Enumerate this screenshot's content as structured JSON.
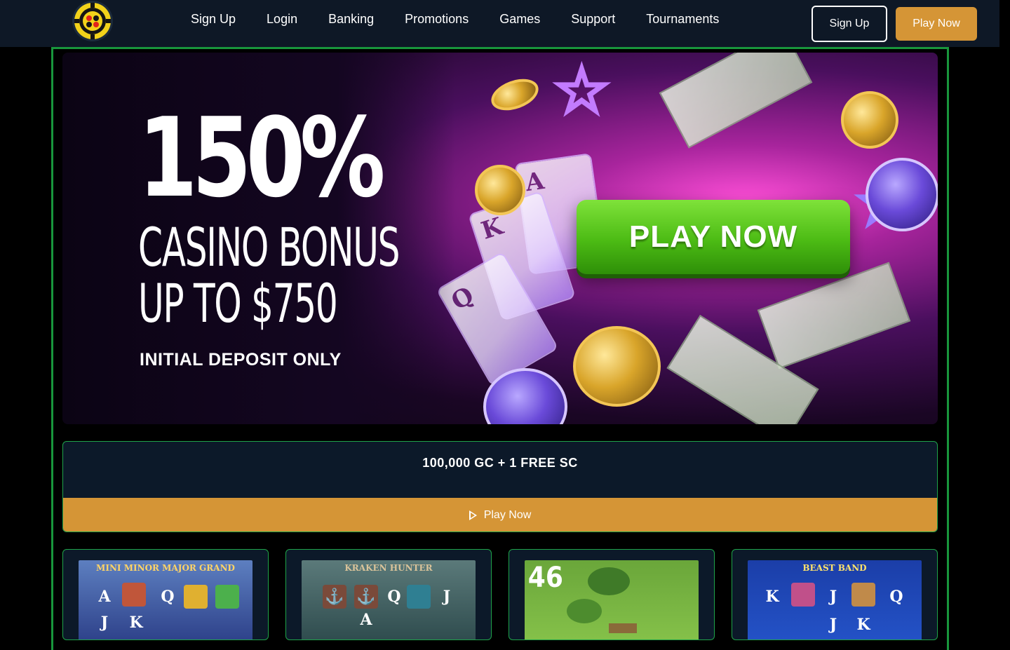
{
  "nav": {
    "items": [
      {
        "label": "Sign Up"
      },
      {
        "label": "Login"
      },
      {
        "label": "Banking"
      },
      {
        "label": "Promotions"
      },
      {
        "label": "Games"
      },
      {
        "label": "Support"
      },
      {
        "label": "Tournaments"
      }
    ],
    "signup_button": "Sign Up",
    "play_button": "Play Now"
  },
  "banner": {
    "headline": "150%",
    "line1": "CASINO BONUS",
    "line2": "UP TO $750",
    "subtext": "INITIAL DEPOSIT ONLY",
    "cta": "PLAY NOW",
    "card_ranks": [
      "A",
      "K",
      "Q"
    ]
  },
  "promo": {
    "title": "100,000 GC + 1 FREE SC",
    "button_label": "Play Now"
  },
  "games": [
    {
      "label": "MINI MINOR MAJOR GRAND",
      "symbols": [
        "A",
        "Q",
        "J",
        "K"
      ]
    },
    {
      "label": "KRAKEN HUNTER",
      "symbols": [
        "A",
        "Q",
        "J"
      ]
    },
    {
      "label": "46",
      "symbols": []
    },
    {
      "label": "BEAST BAND",
      "symbols": [
        "K",
        "J",
        "Q",
        "J",
        "K"
      ]
    }
  ],
  "colors": {
    "topbar": "#0e1826",
    "accent_orange": "#d59536",
    "frame_green": "#18963c",
    "cta_green": "#4cbb14"
  }
}
